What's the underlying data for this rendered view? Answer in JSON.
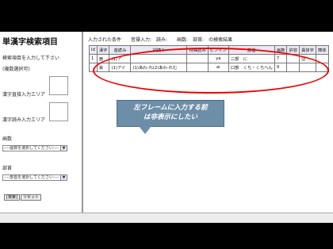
{
  "left_panel": {
    "title": "単漢字検索項目",
    "instruction_line1": "検索項目を入力して下さい",
    "instruction_line2": "(複数選択可)",
    "kanji_input_label": "漢字直接入力エリア",
    "reading_input_label": "漢字読み入力エリア",
    "strokes_label": "画数",
    "strokes_select": "----画数を選択してください----",
    "radical_label": "部首",
    "radical_select": "----部首を選択してください----",
    "search_button": "[検索]",
    "reset_button": "リセット"
  },
  "right_panel": {
    "conditions_text": "入力された条件　　音操入力:　読み:　　画数:　部首:　の検索結果",
    "table": {
      "headers": [
        "id",
        "漢字",
        "音読み",
        "訓読み",
        "特殊読み",
        "ピンイン",
        "部首",
        "画数",
        "許容",
        "異体字",
        "簡体"
      ],
      "rows": [
        [
          "1",
          "亜",
          "(1)ア",
          "",
          "",
          "ya",
          "二部　に",
          "7",
          "",
          "亞",
          ""
        ],
        [
          "",
          "哀",
          "(1)アイ",
          "(1)あわ-れ(2)あわ-れむ",
          "",
          "ai",
          "口部　くち・くちへん",
          "9",
          "",
          "",
          ""
        ]
      ]
    },
    "callout": {
      "line1": "左フレームに入力する前",
      "line2": "は非表示にしたい"
    }
  },
  "colors": {
    "ellipse": "#e00000",
    "callout_bg": "#6d8ea7"
  }
}
